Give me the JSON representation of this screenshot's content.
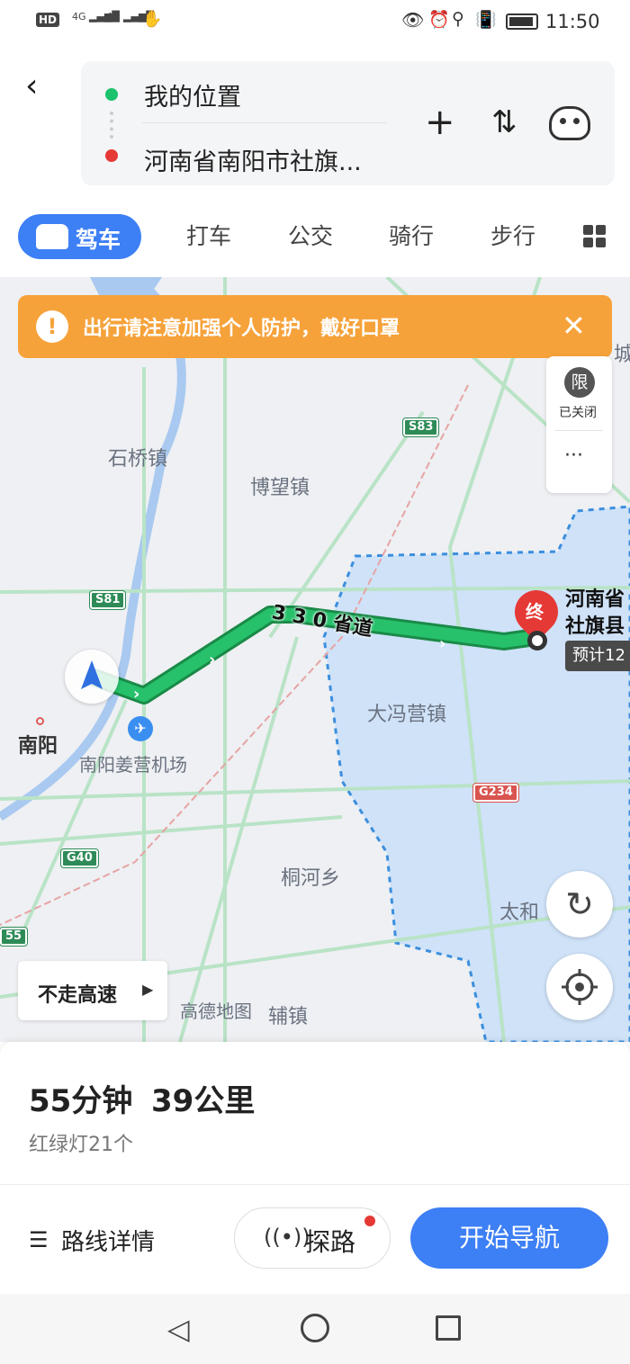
{
  "status_bar": {
    "left_badge": "HD",
    "signal1": "4G",
    "signal2": "4G",
    "time": "11:50"
  },
  "route": {
    "from": "我的位置",
    "to": "河南省南阳市社旗..."
  },
  "modes": [
    {
      "label": "驾车",
      "active": true
    },
    {
      "label": "打车"
    },
    {
      "label": "公交"
    },
    {
      "label": "骑行"
    },
    {
      "label": "步行"
    }
  ],
  "notice": {
    "text": "出行请注意加强个人防护，戴好口罩"
  },
  "limit": {
    "badge": "限",
    "text": "已关闭",
    "more": "···"
  },
  "map": {
    "places": [
      "石桥镇",
      "博望镇",
      "大冯营镇",
      "南阳",
      "南阳姜营机场",
      "桐河乡",
      "太和",
      "高德地图",
      "辅镇",
      "河南省",
      "社旗县",
      "城"
    ],
    "shields": [
      "S83",
      "S81",
      "G40",
      "G234",
      "55"
    ],
    "road_label": "3 3 0 省道",
    "end_badge": "终",
    "eta_tag": "预计12",
    "avoid_highway": "不走高速"
  },
  "summary": {
    "duration": "55分钟",
    "distance": "39公里",
    "lights": "红绿灯21个"
  },
  "actions": {
    "details": "路线详情",
    "explore": "探路",
    "start": "开始导航"
  }
}
